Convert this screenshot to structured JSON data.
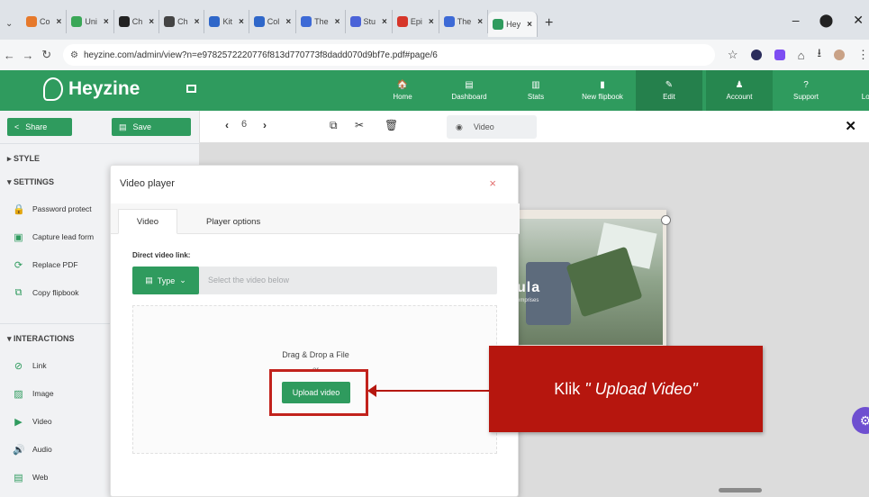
{
  "browser": {
    "tabs": [
      {
        "label": "Co",
        "color": "#e6792b"
      },
      {
        "label": "Uni",
        "color": "#3aa757"
      },
      {
        "label": "Ch",
        "color": "#222222"
      },
      {
        "label": "Ch",
        "color": "#444444"
      },
      {
        "label": "Kit",
        "color": "#2f67c9"
      },
      {
        "label": "Col",
        "color": "#2f67c9"
      },
      {
        "label": "The",
        "color": "#3d6ad6"
      },
      {
        "label": "Stu",
        "color": "#4a63d8"
      },
      {
        "label": "Epi",
        "color": "#d6362a"
      },
      {
        "label": "The",
        "color": "#3d6ad6"
      },
      {
        "label": "Hey",
        "color": "#2f9b5e"
      }
    ],
    "url": "heyzine.com/admin/view?n=e97825722207​76f813d770773f8dadd070d9bf7e.pdf#page/6"
  },
  "app": {
    "brand": "Heyzine",
    "nav": [
      {
        "label": "Home",
        "icon": "🏠"
      },
      {
        "label": "Dashboard",
        "icon": "▤"
      },
      {
        "label": "Stats",
        "icon": "▥"
      },
      {
        "label": "New flipbook",
        "icon": "▮"
      },
      {
        "label": "Edit",
        "icon": "✎"
      },
      {
        "label": "Account",
        "icon": "♟"
      },
      {
        "label": "Support",
        "icon": "?"
      },
      {
        "label": "Logout",
        "icon": "⏻"
      }
    ]
  },
  "sidebar": {
    "share": "Share",
    "save": "Save",
    "style": "▸ STYLE",
    "settings": "▾ SETTINGS",
    "settings_items": [
      {
        "label": "Password protect",
        "icon": "🔒"
      },
      {
        "label": "Capture lead form",
        "icon": "▣"
      },
      {
        "label": "Replace PDF",
        "icon": "⟳"
      },
      {
        "label": "Copy flipbook",
        "icon": "⧉"
      }
    ],
    "interactions": "▾ INTERACTIONS",
    "interaction_items": [
      {
        "label": "Link",
        "icon": "⊘"
      },
      {
        "label": "Image",
        "icon": "▨"
      },
      {
        "label": "Video",
        "icon": "▶"
      },
      {
        "label": "Audio",
        "icon": "🔊"
      },
      {
        "label": "Web",
        "icon": "▤"
      }
    ]
  },
  "toolbar": {
    "page": "6",
    "video_chip": "Video"
  },
  "canvas": {
    "page_text": "ula",
    "page_subtext": "emprises"
  },
  "modal": {
    "title": "Video player",
    "tab_active": "Video",
    "tab_other": "Player options",
    "direct_label": "Direct video link:",
    "type_button": "Type",
    "placeholder": "Select the video below",
    "drag_drop": "Drag & Drop a File",
    "or": "or",
    "upload": "Upload video"
  },
  "annotation": {
    "prefix": "Klik ",
    "quoted": "\" Upload Video\""
  }
}
